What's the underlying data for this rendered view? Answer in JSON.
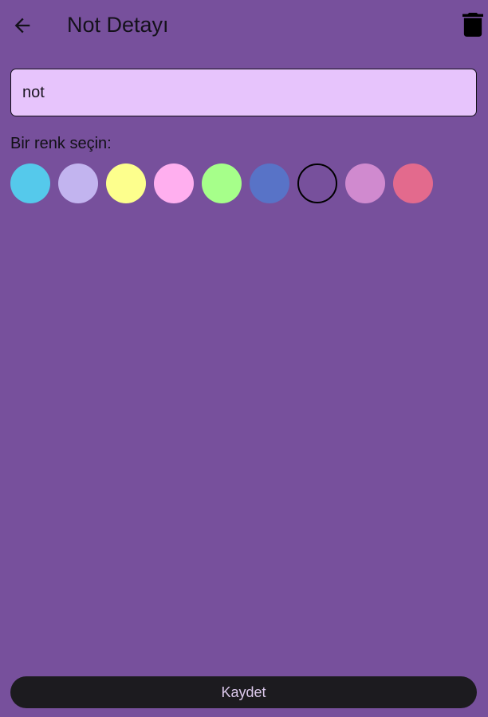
{
  "app_bar": {
    "title": "Not Detayı",
    "back_icon": "arrow-left-icon",
    "delete_icon": "trash-icon"
  },
  "note": {
    "value": "not",
    "placeholder": ""
  },
  "colors": {
    "label": "Bir renk seçin:",
    "selected_index": 6,
    "swatches": [
      "#55c9eb",
      "#c2b4ef",
      "#fdff8d",
      "#ffafef",
      "#a6ff8a",
      "#5873c7",
      "#77509c",
      "#d08acf",
      "#e36a8d"
    ]
  },
  "theme": {
    "background": "#77509c",
    "field_fill": "#e7c4fc",
    "button_fill": "#1c1b1f",
    "button_text": "#dcc9ec"
  },
  "actions": {
    "save_label": "Kaydet"
  }
}
